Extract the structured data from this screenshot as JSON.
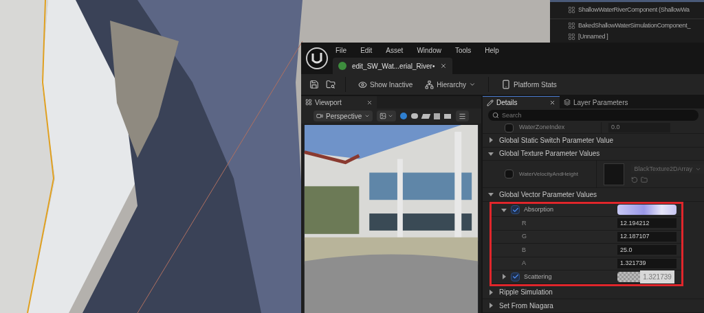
{
  "outliner": {
    "items": [
      {
        "label": "ShallowWaterRiverComponent (ShallowWa"
      },
      {
        "label": "BakedShallowWaterSimulationComponent_"
      },
      {
        "label": "[Unnamed ]"
      }
    ]
  },
  "editor": {
    "menu": [
      "File",
      "Edit",
      "Asset",
      "Window",
      "Tools",
      "Help"
    ],
    "document_tab": {
      "label": "edit_SW_Wat...erial_River•"
    },
    "toolbar": [
      {
        "kind": "show",
        "label": "Show Inactive"
      },
      {
        "kind": "hierarchy",
        "label": "Hierarchy"
      },
      {
        "kind": "stats",
        "label": "Platform Stats"
      }
    ],
    "viewport": {
      "tab": "Viewport",
      "view_mode": "Perspective"
    },
    "details": {
      "tabs": [
        {
          "label": "Details",
          "selected": true
        },
        {
          "label": "Layer Parameters",
          "selected": false
        }
      ],
      "search": {
        "placeholder": "Search"
      },
      "rows": [
        {
          "kind": "param",
          "name": "WaterZoneIndex",
          "value": "0.0",
          "checked": false,
          "highlighted": false
        },
        {
          "kind": "group",
          "label": "Global Static Switch Parameter Value",
          "expanded": false,
          "highlighted": false
        },
        {
          "kind": "group",
          "label": "Global Texture Parameter Values",
          "expanded": true,
          "highlighted": false
        },
        {
          "kind": "texture",
          "name": "WaterVelocityAndHeight",
          "value": "BlackTexture2DArray",
          "checked": false,
          "highlighted": false
        },
        {
          "kind": "group",
          "label": "Global Vector Parameter Values",
          "expanded": true,
          "highlighted": false
        },
        {
          "kind": "vector",
          "name": "Absorption",
          "checked": true,
          "expanded": true,
          "highlighted": true
        },
        {
          "kind": "component",
          "name": "R",
          "value": "12.194212",
          "highlighted": true
        },
        {
          "kind": "component",
          "name": "G",
          "value": "12.187107",
          "highlighted": true
        },
        {
          "kind": "component",
          "name": "B",
          "value": "25.0",
          "highlighted": true
        },
        {
          "kind": "component",
          "name": "A",
          "value": "1.321739",
          "highlighted": true
        },
        {
          "kind": "vector",
          "name": "Scattering",
          "checked": true,
          "expanded": false,
          "drag_value": "1.321739",
          "highlighted": true
        },
        {
          "kind": "group",
          "label": "Ripple Simulation",
          "expanded": false,
          "highlighted": false
        },
        {
          "kind": "group",
          "label": "Set From Niagara",
          "expanded": false,
          "highlighted": false
        }
      ]
    }
  }
}
